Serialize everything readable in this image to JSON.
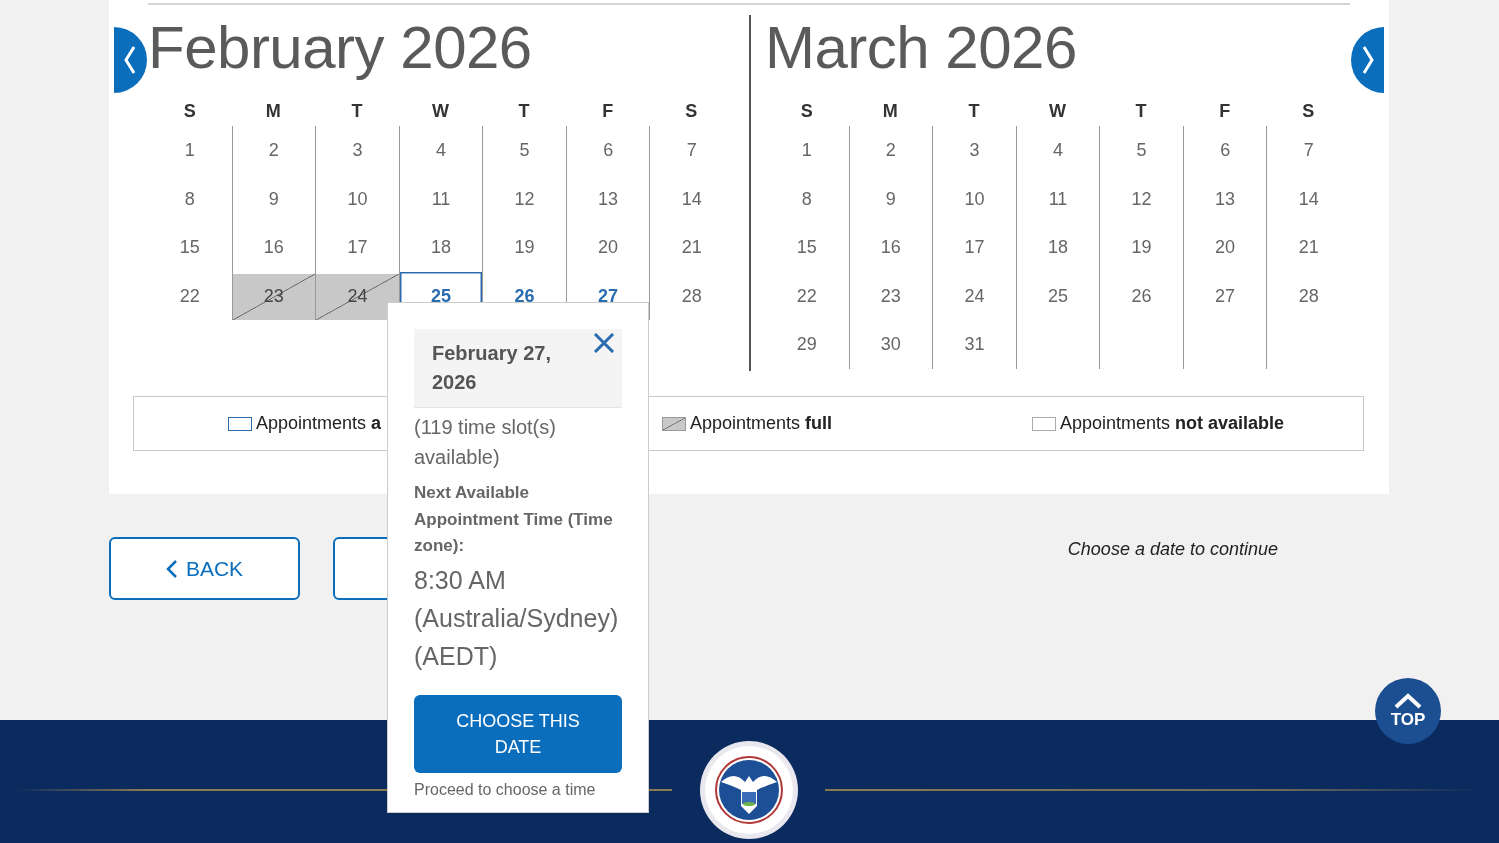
{
  "calendars": [
    {
      "title": "February 2026",
      "weekdays": [
        "S",
        "M",
        "T",
        "W",
        "T",
        "F",
        "S"
      ],
      "weeks": [
        [
          {
            "day": "1",
            "kind": "normal"
          },
          {
            "day": "2",
            "kind": "normal"
          },
          {
            "day": "3",
            "kind": "normal"
          },
          {
            "day": "4",
            "kind": "normal"
          },
          {
            "day": "5",
            "kind": "normal"
          },
          {
            "day": "6",
            "kind": "normal"
          },
          {
            "day": "7",
            "kind": "normal"
          }
        ],
        [
          {
            "day": "8",
            "kind": "normal"
          },
          {
            "day": "9",
            "kind": "normal"
          },
          {
            "day": "10",
            "kind": "normal"
          },
          {
            "day": "11",
            "kind": "normal"
          },
          {
            "day": "12",
            "kind": "normal"
          },
          {
            "day": "13",
            "kind": "normal"
          },
          {
            "day": "14",
            "kind": "normal"
          }
        ],
        [
          {
            "day": "15",
            "kind": "normal"
          },
          {
            "day": "16",
            "kind": "normal"
          },
          {
            "day": "17",
            "kind": "normal"
          },
          {
            "day": "18",
            "kind": "normal"
          },
          {
            "day": "19",
            "kind": "normal"
          },
          {
            "day": "20",
            "kind": "normal"
          },
          {
            "day": "21",
            "kind": "normal"
          }
        ],
        [
          {
            "day": "22",
            "kind": "normal"
          },
          {
            "day": "23",
            "kind": "full"
          },
          {
            "day": "24",
            "kind": "full"
          },
          {
            "day": "25",
            "kind": "focused"
          },
          {
            "day": "26",
            "kind": "available"
          },
          {
            "day": "27",
            "kind": "available"
          },
          {
            "day": "28",
            "kind": "normal"
          }
        ]
      ]
    },
    {
      "title": "March 2026",
      "weekdays": [
        "S",
        "M",
        "T",
        "W",
        "T",
        "F",
        "S"
      ],
      "weeks": [
        [
          {
            "day": "1",
            "kind": "normal"
          },
          {
            "day": "2",
            "kind": "normal"
          },
          {
            "day": "3",
            "kind": "normal"
          },
          {
            "day": "4",
            "kind": "normal"
          },
          {
            "day": "5",
            "kind": "normal"
          },
          {
            "day": "6",
            "kind": "normal"
          },
          {
            "day": "7",
            "kind": "normal"
          }
        ],
        [
          {
            "day": "8",
            "kind": "normal"
          },
          {
            "day": "9",
            "kind": "normal"
          },
          {
            "day": "10",
            "kind": "normal"
          },
          {
            "day": "11",
            "kind": "normal"
          },
          {
            "day": "12",
            "kind": "normal"
          },
          {
            "day": "13",
            "kind": "normal"
          },
          {
            "day": "14",
            "kind": "normal"
          }
        ],
        [
          {
            "day": "15",
            "kind": "normal"
          },
          {
            "day": "16",
            "kind": "normal"
          },
          {
            "day": "17",
            "kind": "normal"
          },
          {
            "day": "18",
            "kind": "normal"
          },
          {
            "day": "19",
            "kind": "normal"
          },
          {
            "day": "20",
            "kind": "normal"
          },
          {
            "day": "21",
            "kind": "normal"
          }
        ],
        [
          {
            "day": "22",
            "kind": "normal"
          },
          {
            "day": "23",
            "kind": "normal"
          },
          {
            "day": "24",
            "kind": "normal"
          },
          {
            "day": "25",
            "kind": "normal"
          },
          {
            "day": "26",
            "kind": "normal"
          },
          {
            "day": "27",
            "kind": "normal"
          },
          {
            "day": "28",
            "kind": "normal"
          }
        ],
        [
          {
            "day": "29",
            "kind": "normal"
          },
          {
            "day": "30",
            "kind": "normal"
          },
          {
            "day": "31",
            "kind": "normal"
          }
        ]
      ]
    }
  ],
  "legend": [
    {
      "kind": "available",
      "text": "Appointments **a**"
    },
    {
      "kind": "full",
      "text": "Appointments **full**"
    },
    {
      "kind": "unavailable",
      "text": "Appointments **not available**"
    }
  ],
  "back_button": "BACK",
  "continue_hint": "Choose a date to continue",
  "popup": {
    "title": "February 27, 2026",
    "slots": "(119 time slot(s) available)",
    "next_label": "Next Available Appointment Time (Time zone):",
    "next_time": "8:30 AM (Australia/Sydney) (AEDT)",
    "button": "CHOOSE THIS DATE",
    "hint": "Proceed to choose a time"
  },
  "top_button": "TOP"
}
